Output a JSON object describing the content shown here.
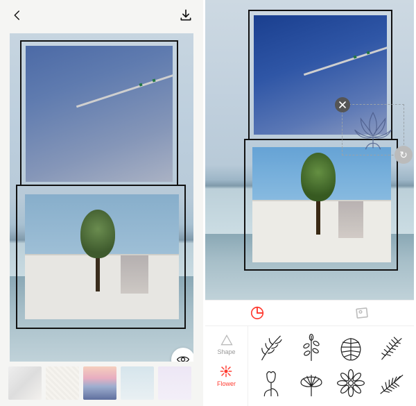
{
  "left": {
    "topbar": {
      "back": "back-icon",
      "download": "download-icon"
    },
    "preview_eye": "preview-eye-icon",
    "filters": [
      "marble",
      "linen",
      "sunset",
      "pale-blue",
      "lavender"
    ]
  },
  "right": {
    "sticker_overlay": {
      "name": "lotus-flower",
      "close_label": "✕",
      "rotate_label": "↻"
    },
    "mode_tabs": {
      "sticker": "sticker-mode-icon",
      "photo": "photo-mode-icon",
      "active": "sticker"
    },
    "categories": [
      {
        "id": "shape",
        "label": "Shape",
        "active": false
      },
      {
        "id": "flower",
        "label": "Flower",
        "active": true
      }
    ],
    "stickers": [
      "branch-leaves",
      "sprig",
      "monstera-leaf",
      "palm-branch",
      "tulip",
      "ginkgo-fan",
      "dahlia",
      "fern-frond"
    ]
  }
}
